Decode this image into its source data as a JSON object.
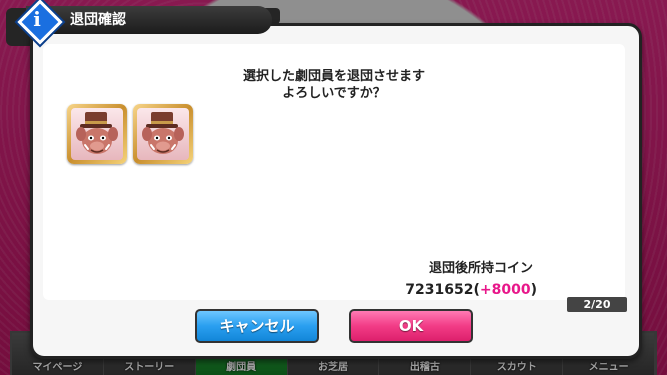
{
  "dialog": {
    "title": "退団確認",
    "info_glyph": "i",
    "message_line1": "選択した劇団員を退団させます",
    "message_line2": "よろしいですか？",
    "coin_label": "退団後所持コイン",
    "coin_amount": "7231652",
    "coin_open": "(",
    "coin_bonus": "+8000",
    "coin_close": ")",
    "page_indicator": "2/20",
    "cancel_label": "キャンセル",
    "ok_label": "OK"
  },
  "selected_cards": [
    {
      "icon": "top-hat-boar-mascot-icon"
    },
    {
      "icon": "top-hat-boar-mascot-icon"
    }
  ],
  "bottom_nav": [
    {
      "label": "マイページ"
    },
    {
      "label": "ストーリー"
    },
    {
      "label": "劇団員"
    },
    {
      "label": "お芝居"
    },
    {
      "label": "出稽古"
    },
    {
      "label": "スカウト"
    },
    {
      "label": "メニュー"
    }
  ],
  "colors": {
    "accent_pink": "#e8178a",
    "cancel_blue": "#2a9ff0",
    "ok_pink": "#f23c86",
    "info_blue": "#1a6fe0",
    "background_magenta": "#c8196e"
  }
}
